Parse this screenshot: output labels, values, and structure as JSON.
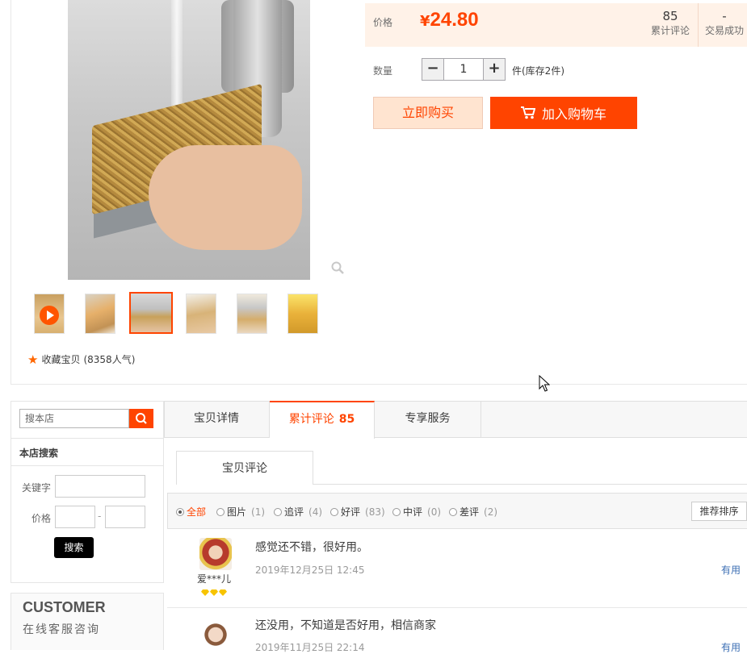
{
  "product": {
    "fav_label": "收藏宝贝",
    "fav_count": "(8358人气)",
    "thumbnails": [
      "video-thumb",
      "thumb-2",
      "thumb-3",
      "thumb-4",
      "thumb-5",
      "thumb-6"
    ],
    "active_thumb_index": 2
  },
  "price": {
    "label": "价格",
    "currency": "¥",
    "value": "24.80",
    "reviews_count": "85",
    "reviews_label": "累计评论",
    "deals_count": "-",
    "deals_label": "交易成功"
  },
  "quantity": {
    "label": "数量",
    "minus": "−",
    "value": "1",
    "plus": "+",
    "stock": "件(库存2件)"
  },
  "buttons": {
    "buy_now": "立即购买",
    "add_cart": "加入购物车"
  },
  "shop_search": {
    "placeholder": "搜本店",
    "title": "本店搜索",
    "keyword_label": "关键字",
    "price_label": "价格",
    "price_dash": "-",
    "submit": "搜索"
  },
  "customer": {
    "title": "CUSTOMER",
    "subtitle": "在线客服咨询"
  },
  "tabs": [
    {
      "label": "宝贝详情",
      "count": ""
    },
    {
      "label": "累计评论",
      "count": "85"
    },
    {
      "label": "专享服务",
      "count": ""
    }
  ],
  "review_section": {
    "subtab": "宝贝评论",
    "filters": [
      {
        "label": "全部",
        "count": ""
      },
      {
        "label": "图片",
        "count": "(1)"
      },
      {
        "label": "追评",
        "count": "(4)"
      },
      {
        "label": "好评",
        "count": "(83)"
      },
      {
        "label": "中评",
        "count": "(0)"
      },
      {
        "label": "差评",
        "count": "(2)"
      }
    ],
    "sort": "推荐排序"
  },
  "reviews": [
    {
      "user": "爱***儿",
      "text": "感觉还不错，很好用。",
      "date": "2019年12月25日 12:45",
      "useful": "有用"
    },
    {
      "user": "",
      "text": "还没用，不知道是否好用，相信商家",
      "date": "2019年11月25日 22:14",
      "useful": "有用"
    }
  ],
  "colors": {
    "accent": "#ff4400",
    "price_bg": "#fff2e8",
    "link": "#3d6fb4"
  }
}
